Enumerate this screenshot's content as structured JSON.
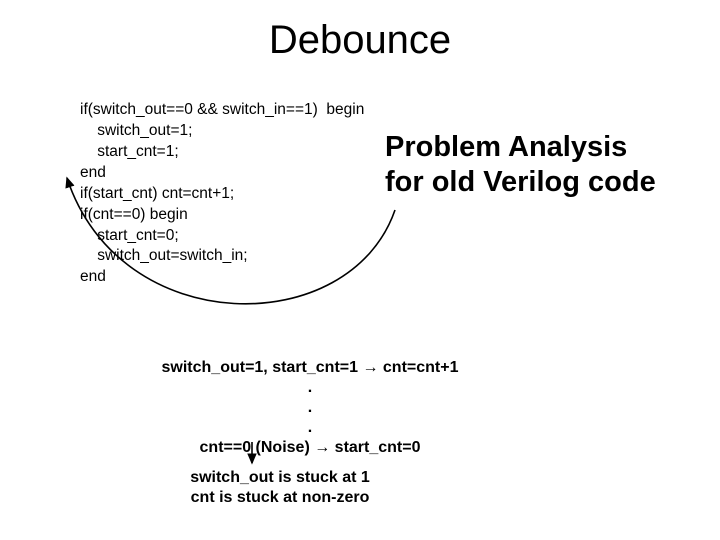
{
  "title": "Debounce",
  "code": "if(switch_out==0 && switch_in==1)  begin\n    switch_out=1;\n    start_cnt=1;\nend\nif(start_cnt) cnt=cnt+1;\nif(cnt==0) begin\n    start_cnt=0;\n    switch_out=switch_in;\nend",
  "analysis_line1": "Problem Analysis",
  "analysis_line2": "for old Verilog code",
  "trace_line1": "switch_out=1, start_cnt=1 → cnt=cnt+1",
  "trace_dot1": ".",
  "trace_dot2": ".",
  "trace_dot3": ".",
  "trace_line2": "cnt==0 (Noise) → start_cnt=0",
  "conclusion_line1": "switch_out is stuck at 1",
  "conclusion_line2": "cnt is stuck at non-zero"
}
